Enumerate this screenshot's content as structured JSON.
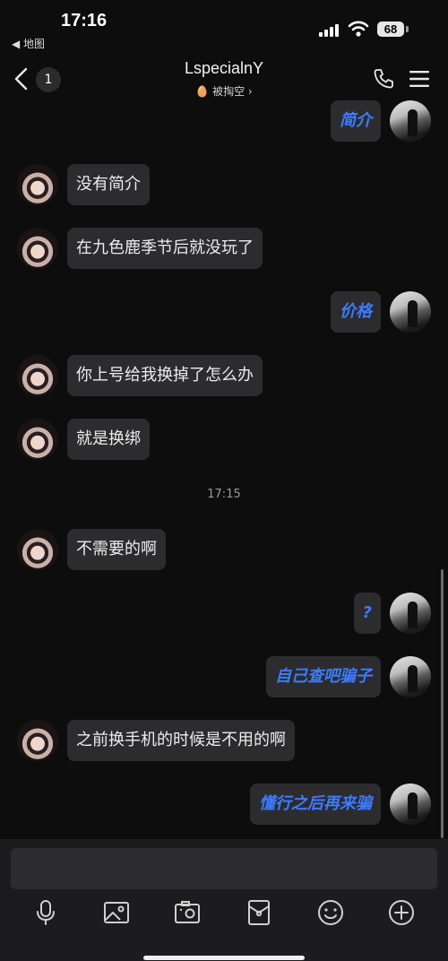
{
  "status": {
    "time": "17:16",
    "back_app": "◀ 地图",
    "battery": "68"
  },
  "header": {
    "contact_name": "LspecialnY",
    "unread": "1",
    "sub_status": "被掏空 ›"
  },
  "messages": [
    {
      "side": "self",
      "text": "简介"
    },
    {
      "side": "peer",
      "text": "没有简介"
    },
    {
      "side": "peer",
      "text": "在九色鹿季节后就没玩了"
    },
    {
      "side": "self",
      "text": "价格"
    },
    {
      "side": "peer",
      "text": "你上号给我换掉了怎么办"
    },
    {
      "side": "peer",
      "text": "就是换绑"
    },
    {
      "side": "time",
      "text": "17:15"
    },
    {
      "side": "peer",
      "text": "不需要的啊"
    },
    {
      "side": "self",
      "text": "?"
    },
    {
      "side": "self",
      "text": "自己查吧骗子"
    },
    {
      "side": "peer",
      "text": "之前换手机的时候是不用的啊"
    },
    {
      "side": "self",
      "text": "懂行之后再来骗"
    }
  ],
  "input": {
    "value": "",
    "placeholder": ""
  },
  "toolbar": [
    "microphone-icon",
    "image-icon",
    "camera-icon",
    "red-packet-icon",
    "emoji-icon",
    "plus-icon"
  ]
}
